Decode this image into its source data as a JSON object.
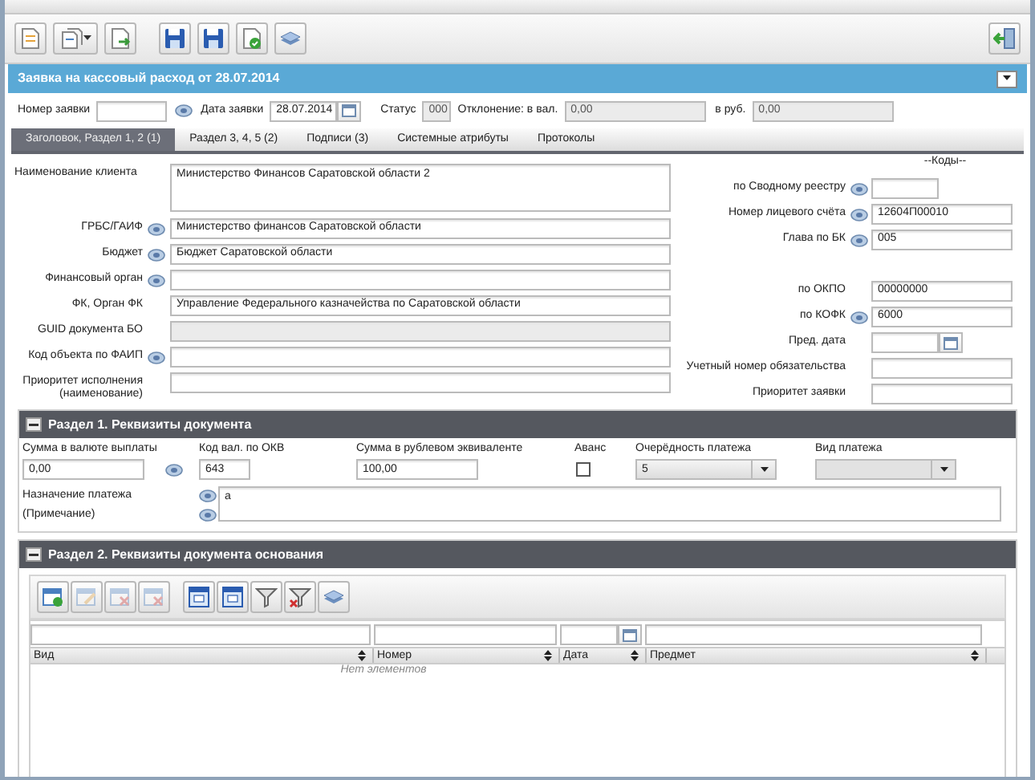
{
  "title": "Заявка на кассовый расход от 28.07.2014",
  "header_fields": [
    {
      "label": "Номер заявки",
      "kind": "lookup"
    },
    {
      "label": "Дата заявки",
      "value": "28.07.2014",
      "kind": "date"
    },
    {
      "label": "Статус",
      "value": "000",
      "kind": "readonly"
    },
    {
      "label": "Отклонение: в вал.",
      "value": "0,00",
      "kind": "readonly"
    },
    {
      "label": "в руб.",
      "value": "0,00",
      "kind": "readonly"
    }
  ],
  "tabs": [
    {
      "label": "Заголовок, Раздел 1, 2 (1)",
      "selected": true
    },
    {
      "label": "Раздел 3, 4, 5 (2)",
      "selected": false
    },
    {
      "label": "Подписи (3)",
      "selected": false
    },
    {
      "label": "Системные атрибуты",
      "selected": false
    },
    {
      "label": "Протоколы",
      "selected": false
    }
  ],
  "client_fields": [
    {
      "label": "Наименование клиента",
      "value": "Министерство Финансов Саратовской области 2",
      "kind": "textarea",
      "lookup": false
    },
    {
      "label": "ГРБС/ГАИФ",
      "value": "Министерство финансов Саратовской области",
      "kind": "text",
      "lookup": true
    },
    {
      "label": "Бюджет",
      "value": "Бюджет Саратовской области",
      "kind": "text",
      "lookup": true
    },
    {
      "label": "Финансовый орган",
      "kind": "text",
      "lookup": true
    },
    {
      "label": "ФК, Орган ФК",
      "value": "Управление Федерального казначейства по Саратовской области",
      "kind": "text",
      "lookup": false
    },
    {
      "label": "GUID документа БО",
      "kind": "readonly",
      "lookup": false
    },
    {
      "label": "Код объекта по ФАИП",
      "kind": "text",
      "lookup": true
    },
    {
      "label": "Приоритет исполнения (наименование)",
      "kind": "text",
      "lookup": false
    }
  ],
  "codes": {
    "heading": "--Коды--",
    "groups": [
      [
        {
          "label": "по Сводному реестру",
          "kind": "short",
          "lookup": true
        },
        {
          "label": "Номер лицевого счёта",
          "value": "12604П00010",
          "kind": "text",
          "lookup": true
        },
        {
          "label": "Глава по БК",
          "value": "005",
          "kind": "text",
          "lookup": true
        }
      ],
      [
        {
          "label": "по ОКПО",
          "value": "00000000",
          "kind": "text",
          "lookup": false
        },
        {
          "label": "по КОФК",
          "value": "6000",
          "kind": "text",
          "lookup": true
        },
        {
          "label": "Пред. дата",
          "kind": "date",
          "lookup": false
        },
        {
          "label": "Учетный номер обязательства",
          "kind": "text",
          "lookup": false
        },
        {
          "label": "Приоритет заявки",
          "kind": "text",
          "lookup": false
        }
      ]
    ]
  },
  "section_1": {
    "title": "Раздел 1. Реквизиты документа",
    "expanded": true,
    "fields": [
      {
        "label": "Сумма в валюте выплаты",
        "value": "0,00",
        "kind": "text",
        "lookup": false
      },
      {
        "label": "Код вал. по ОКВ",
        "value": "643",
        "kind": "text",
        "lookup": true
      },
      {
        "label": "Сумма в рублевом эквиваленте",
        "value": "100,00",
        "kind": "text",
        "lookup": false
      },
      {
        "label": "Аванс",
        "kind": "checkbox",
        "checked": false
      },
      {
        "label": "Очерёдность платежа",
        "value": "5",
        "kind": "select",
        "disabled": false
      },
      {
        "label": "Вид платежа",
        "kind": "select",
        "disabled": true
      }
    ],
    "purpose": {
      "labels": [
        "Назначение платежа",
        "(Примечание)"
      ],
      "value": "а"
    }
  },
  "section_2": {
    "title": "Раздел 2. Реквизиты документа основания",
    "expanded": true,
    "toolbar": [
      {
        "disabled": false
      },
      {
        "disabled": true
      },
      {
        "disabled": true
      },
      {
        "disabled": true
      },
      {
        "disabled": false
      },
      {
        "disabled": false
      },
      {
        "disabled": false
      },
      {
        "disabled": false
      },
      {
        "disabled": false
      }
    ],
    "columns": [
      {
        "label": "Вид",
        "kind": "text"
      },
      {
        "label": "Номер",
        "kind": "text"
      },
      {
        "label": "Дата",
        "kind": "date"
      },
      {
        "label": "Предмет",
        "kind": "text"
      }
    ],
    "empty_text": "Нет элементов"
  }
}
